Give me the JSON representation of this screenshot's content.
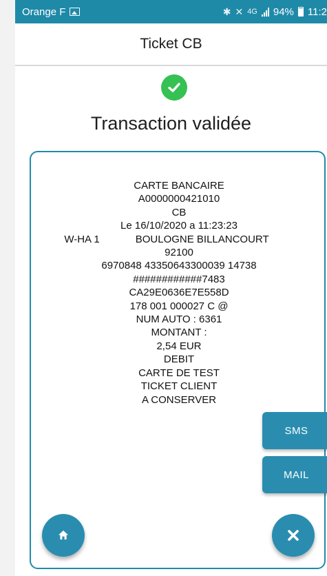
{
  "status_bar": {
    "carrier": "Orange F",
    "network": "4G",
    "battery": "94%",
    "time": "11:2"
  },
  "header": {
    "title": "Ticket CB"
  },
  "result": {
    "title": "Transaction validée"
  },
  "ticket": {
    "lines": [
      "CARTE BANCAIRE",
      "A0000000421010",
      "CB",
      "Le 16/10/2020 a 11:23:23",
      "",
      "92100",
      "6970848 43350643300039 14738",
      "############7483",
      "CA29E0636E7E558D",
      "178 001 000027 C @",
      "NUM AUTO : 6361",
      "MONTANT :",
      "2,54 EUR",
      "DEBIT",
      "CARTE DE TEST",
      "TICKET CLIENT",
      "A CONSERVER"
    ],
    "terminal": "W-HA 1",
    "city": "BOULOGNE BILLANCOURT"
  },
  "buttons": {
    "sms": "SMS",
    "mail": "MAIL"
  },
  "colors": {
    "primary": "#2a8db0",
    "status_bar": "#1f8aa8",
    "success": "#35c153"
  }
}
